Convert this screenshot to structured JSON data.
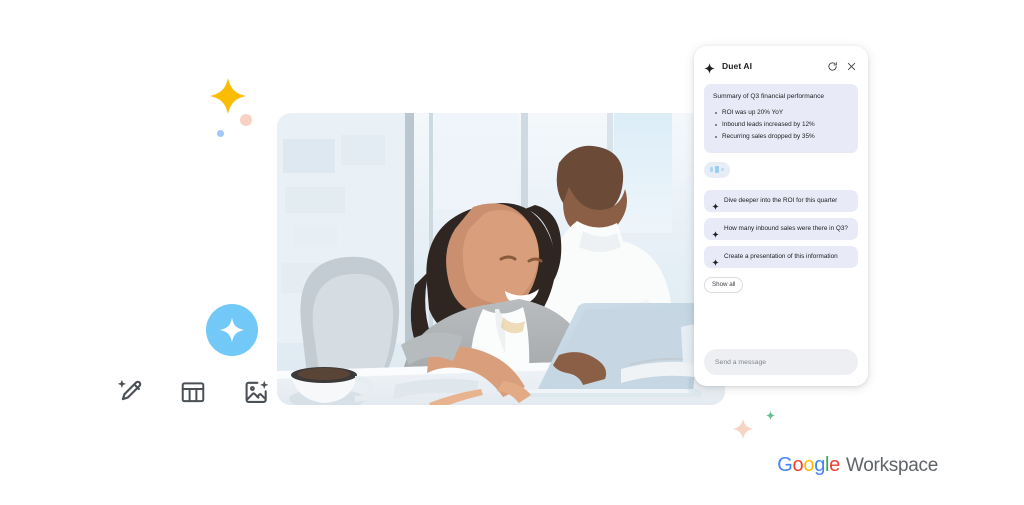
{
  "panel": {
    "title": "Duet AI",
    "icons": {
      "brand": "sparkle-icon",
      "refresh": "refresh-icon",
      "close": "close-icon"
    },
    "summary": {
      "title": "Summary of Q3 financial performance",
      "bullets": [
        "ROI was up 20% YoY",
        "Inbound leads increased by 12%",
        "Recurring sales dropped by 35%"
      ]
    },
    "loading_indicator": "typing-indicator",
    "suggestions": [
      "Dive deeper into the ROI for this quarter",
      "How many inbound sales were there in Q3?",
      "Create a presentation of this information"
    ],
    "show_all_label": "Show all",
    "input": {
      "value": "",
      "placeholder": "Send a message"
    }
  },
  "decor": {
    "badge_icon": "sparkle-icon",
    "badge_color": "#72C8F6",
    "star_yellow": "#FBBC04",
    "star_peach": "#F6D5C6",
    "dot_peach": "#F7D2C4",
    "dot_blue": "#8AB4F8",
    "diamond_green": "#5FBE8D"
  },
  "feature_icons": [
    "magic-pencil-icon",
    "table-icon",
    "image-sparkle-icon"
  ],
  "photo": {
    "alt": "Two colleagues smiling at a laptop in a bright office"
  },
  "logo": {
    "google": [
      "G",
      "o",
      "o",
      "g",
      "l",
      "e"
    ],
    "google_colors": [
      "#4285F4",
      "#EA4335",
      "#FBBC04",
      "#4285F4",
      "#34A853",
      "#EA4335"
    ],
    "workspace": "Workspace"
  }
}
